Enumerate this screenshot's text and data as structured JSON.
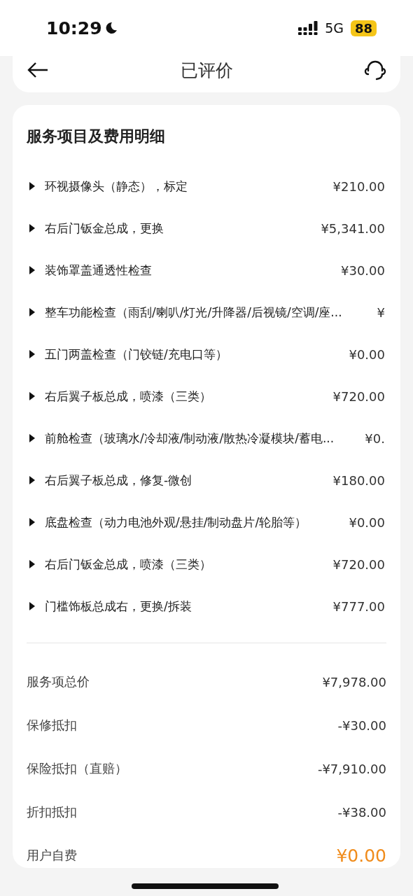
{
  "status_bar": {
    "time": "10:29",
    "network": "5G",
    "battery": "88"
  },
  "header": {
    "title": "已评价"
  },
  "details": {
    "title": "服务项目及费用明细",
    "items": [
      {
        "name": "环视摄像头（静态），标定",
        "price": "¥210.00"
      },
      {
        "name": "右后门钣金总成，更换",
        "price": "¥5,341.00"
      },
      {
        "name": "装饰罩盖通透性检查",
        "price": "¥30.00"
      },
      {
        "name": "整车功能检查（雨刮/喇叭/灯光/升降器/后视镜/空调/座...",
        "price": "¥"
      },
      {
        "name": "五门两盖检查（门铰链/充电口等）",
        "price": "¥0.00"
      },
      {
        "name": "右后翼子板总成，喷漆（三类）",
        "price": "¥720.00"
      },
      {
        "name": "前舱检查（玻璃水/冷却液/制动液/散热冷凝模块/蓄电...",
        "price": "¥0."
      },
      {
        "name": "右后翼子板总成，修复-微创",
        "price": "¥180.00"
      },
      {
        "name": "底盘检查（动力电池外观/悬挂/制动盘片/轮胎等）",
        "price": "¥0.00"
      },
      {
        "name": "右后门钣金总成，喷漆（三类）",
        "price": "¥720.00"
      },
      {
        "name": "门槛饰板总成右，更换/拆装",
        "price": "¥777.00"
      }
    ],
    "summary": [
      {
        "label": "服务项总价",
        "value": "¥7,978.00",
        "kind": "plain"
      },
      {
        "label": "保修抵扣",
        "value": "-¥30.00",
        "kind": "plain"
      },
      {
        "label": "保险抵扣（直赔）",
        "value": "-¥7,910.00",
        "kind": "plain"
      },
      {
        "label": "折扣抵扣",
        "value": "-¥38.00",
        "kind": "plain"
      },
      {
        "label": "用户自费",
        "value": "¥0.00",
        "kind": "total"
      }
    ]
  }
}
